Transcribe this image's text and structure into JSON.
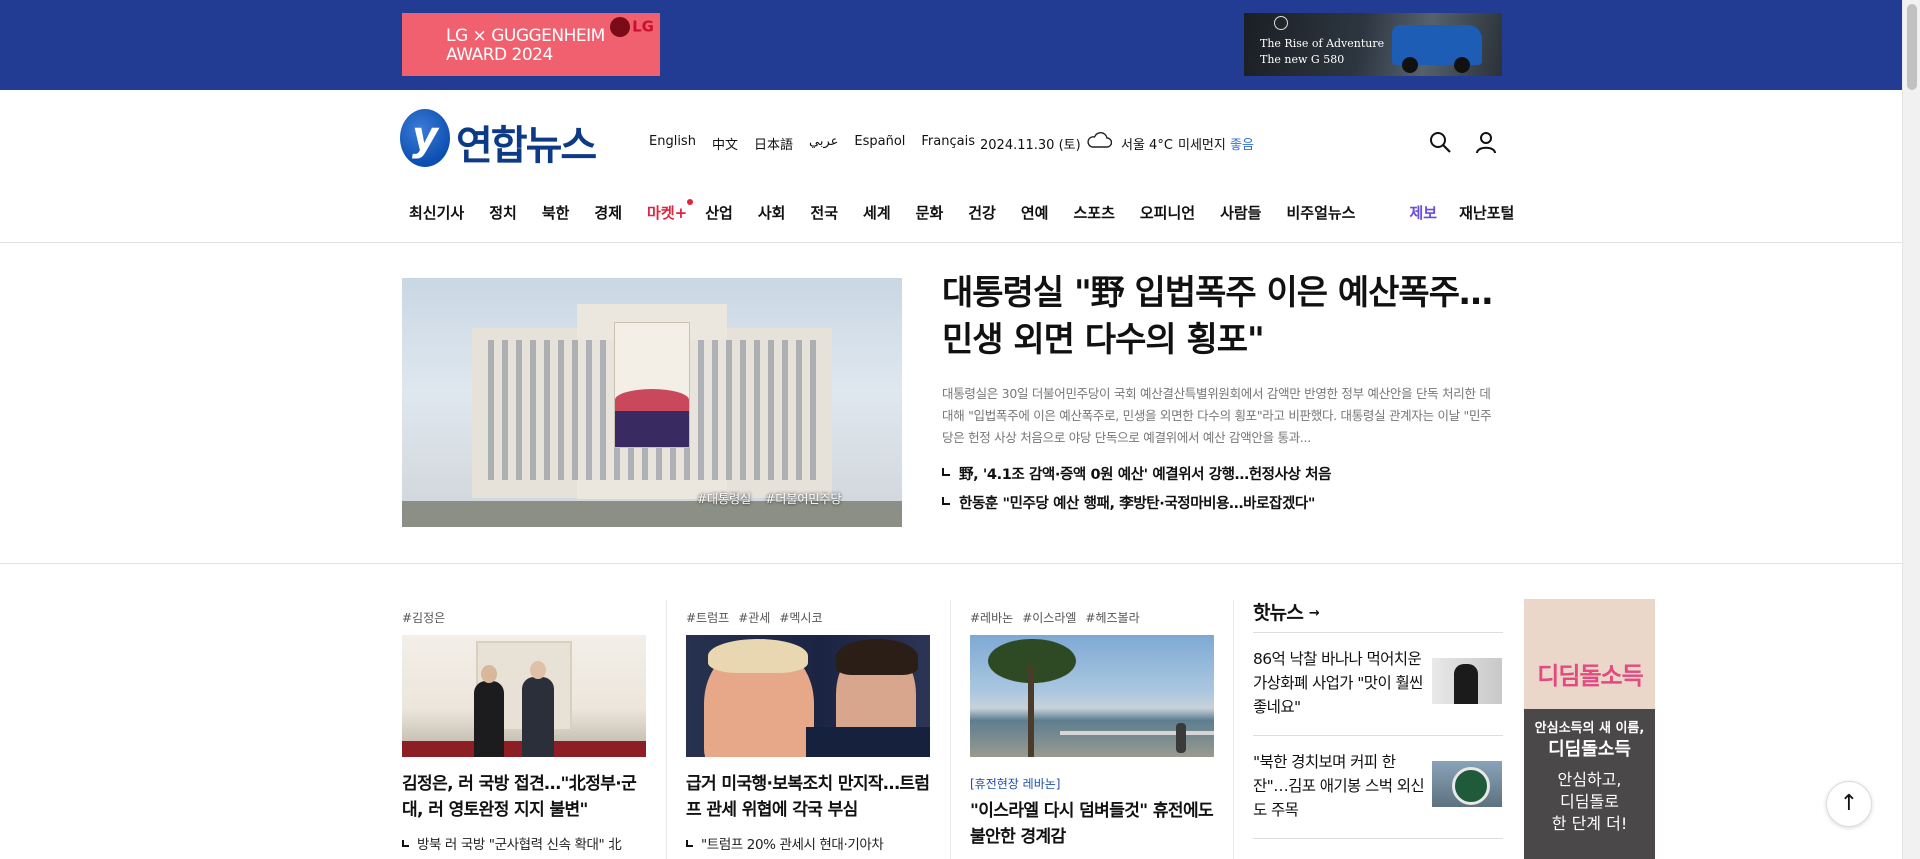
{
  "banner": {
    "lg_ad": {
      "line1": "LG × GUGGENHEIM",
      "line2": "AWARD 2024",
      "brand": "LG"
    },
    "benz_ad": {
      "line1": "The Rise of Adventure",
      "line2": "The new G 580"
    }
  },
  "header": {
    "logo_text": "연합뉴스",
    "languages": [
      "English",
      "中文",
      "日本語",
      "عربي",
      "Español",
      "Français"
    ],
    "date": "2024.11.30 (토)",
    "weather": {
      "city_temp": "서울 4°C",
      "dust_label": "미세먼지",
      "dust_value": "좋음"
    }
  },
  "nav": {
    "items": [
      "최신기사",
      "정치",
      "북한",
      "경제",
      "마켓+",
      "산업",
      "사회",
      "전국",
      "세계",
      "문화",
      "건강",
      "연예",
      "스포츠",
      "오피니언",
      "사람들",
      "비주얼뉴스"
    ],
    "tip": "제보",
    "disaster": "재난포털"
  },
  "headline": {
    "title": "대통령실 \"野 입법폭주 이은 예산폭주…민생 외면 다수의 횡포\"",
    "description": "대통령실은 30일 더불어민주당이 국회 예산결산특별위원회에서 감액만 반영한 정부 예산안을 단독 처리한 데 대해 \"입법폭주에 이은 예산폭주로, 민생을 외면한 다수의 횡포\"라고 비판했다. 대통령실 관계자는 이날 \"민주당은 헌정 사상 처음으로 야당 단독으로 예결위에서 예산 감액안을 통과...",
    "image_tags": [
      "#대통령실",
      "#더불어민주당"
    ],
    "related": [
      "野, '4.1조 감액·증액 0원 예산' 예결위서 강행…헌정사상 처음",
      "한동훈 \"민주당 예산 행패, 李방탄·국정마비용…바로잡겠다\""
    ]
  },
  "cards": [
    {
      "tags": [
        "#김정은"
      ],
      "kicker": "",
      "title": "김정은, 러 국방 접견…\"北정부·군대, 러 영토완정 지지 불변\"",
      "sub": "방북 러 국방 \"군사협력 신속 확대\" 北"
    },
    {
      "tags": [
        "#트럼프",
        "#관세",
        "#멕시코"
      ],
      "kicker": "",
      "title": "급거 미국행·보복조치 만지작…트럼프 관세 위협에 각국 부심",
      "sub": "\"트럼프 20% 관세시 현대·기아차"
    },
    {
      "tags": [
        "#레바논",
        "#이스라엘",
        "#헤즈볼라"
      ],
      "kicker": "[휴전현장 레바논]",
      "title": "\"이스라엘 다시 덤벼들것\" 휴전에도 불안한 경계감",
      "sub": ""
    }
  ],
  "hot_news": {
    "title": "핫뉴스",
    "items": [
      "86억 낙찰 바나나 먹어치운 가상화폐 사업가 \"맛이 훨씬 좋네요\"",
      "\"북한 경치보며 커피 한잔\"…김포 애기봉 스벅 외신도 주목"
    ]
  },
  "side_ad": {
    "big": "디딤돌소득",
    "line1": "안심소득의 새 이름,",
    "line2": "디딤돌소득",
    "line3": "안심하고,\n디딤돌로\n한 단계 더!"
  },
  "to_top_glyph": "↑"
}
